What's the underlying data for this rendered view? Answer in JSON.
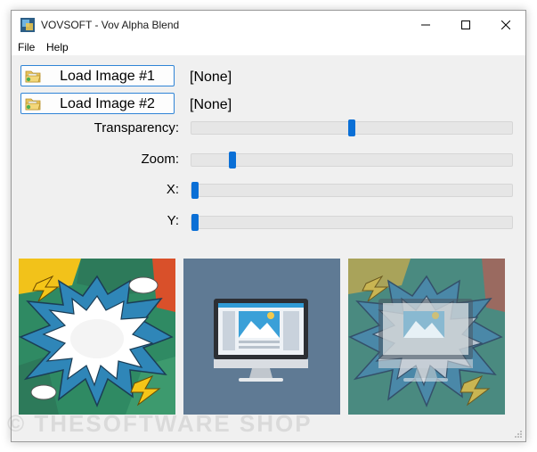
{
  "window": {
    "title": "VOVSOFT - Vov Alpha Blend"
  },
  "menu": {
    "file": "File",
    "help": "Help"
  },
  "load1": {
    "label": "Load Image #1",
    "file": "[None]"
  },
  "load2": {
    "label": "Load Image #2",
    "file": "[None]"
  },
  "sliders": {
    "transparency": {
      "label": "Transparency:",
      "value": 0.5
    },
    "zoom": {
      "label": "Zoom:",
      "value": 0.12
    },
    "x": {
      "label": "X:",
      "value": 0.0
    },
    "y": {
      "label": "Y:",
      "value": 0.0
    }
  },
  "watermark": "© THESOFTWARE SHOP",
  "colors": {
    "accent": "#0a6fd6",
    "button_border": "#2f84d6",
    "preview_bg": "#5f7a94"
  },
  "icons": [
    "app-icon",
    "minimize-icon",
    "maximize-icon",
    "close-icon",
    "folder-icon",
    "resize-grip-icon"
  ]
}
